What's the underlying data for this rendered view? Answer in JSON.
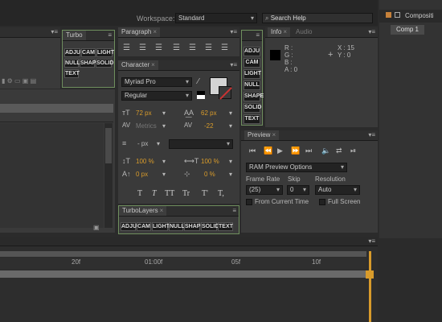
{
  "topbar": {
    "workspace_label": "Workspace:",
    "workspace_value": "Standard",
    "search_placeholder": "Search Help"
  },
  "turbo": {
    "title": "Turbo",
    "buttons": [
      "ADJU",
      "CAM",
      "LIGHT",
      "NULL",
      "SHAPE",
      "SOLID",
      "TEXT"
    ]
  },
  "paragraph": {
    "tab": "Paragraph"
  },
  "character": {
    "tab": "Character",
    "font_family": "Myriad Pro",
    "font_style": "Regular",
    "size": "72 px",
    "leading": "62 px",
    "kerning": "Metrics",
    "tracking": "-22",
    "stroke": "- px",
    "vscale": "100 %",
    "hscale": "100 %",
    "baseline": "0 px",
    "tsume": "0 %",
    "styles": [
      "T",
      "T",
      "TT",
      "Tr",
      "T'",
      "T,"
    ]
  },
  "turbolayers": {
    "tab": "TurboLayers",
    "buttons": [
      "ADJU",
      "CAM",
      "LIGHT",
      "NULL",
      "SHAPE",
      "SOLID",
      "TEXT"
    ]
  },
  "info": {
    "tabs": [
      "Info",
      "Audio"
    ],
    "r": "R :",
    "g": "G :",
    "b": "B :",
    "a": "A : 0",
    "x": "X : 15",
    "y": "Y : 0"
  },
  "composition": {
    "tab": "Compositi",
    "comp": "Comp 1"
  },
  "preview": {
    "tab": "Preview",
    "options": "RAM Preview Options",
    "frame_rate_label": "Frame Rate",
    "frame_rate": "(25)",
    "skip_label": "Skip",
    "skip": "0",
    "resolution_label": "Resolution",
    "resolution": "Auto",
    "from_current": "From Current Time",
    "full_screen": "Full Screen"
  },
  "timeline": {
    "ticks": [
      "20f",
      "01:00f",
      "05f",
      "10f"
    ]
  },
  "colors": {
    "accent": "#d89b2b",
    "turbo_green": "#6f8f5e"
  }
}
